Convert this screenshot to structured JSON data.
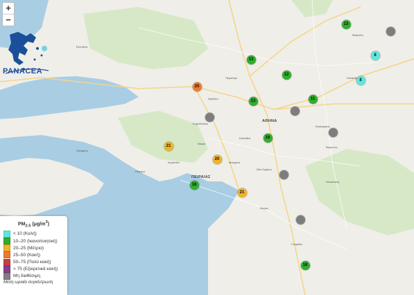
{
  "map": {
    "zoom_in": "+",
    "zoom_out": "−",
    "logo_text": "PANACEA",
    "places": [
      {
        "id": "athina",
        "label": "ΑΘΗΝΑ",
        "big": true
      },
      {
        "id": "peiraias",
        "label": "ΠΕΙΡΑΙΑΣ",
        "big": true
      },
      {
        "id": "korydallos",
        "label": "Κορυδαλλός",
        "big": false
      },
      {
        "id": "keratsini",
        "label": "Κερατσίνι",
        "big": false
      },
      {
        "id": "perama",
        "label": "Πέραμα",
        "big": false
      },
      {
        "id": "nikaia",
        "label": "Νίκαια",
        "big": false
      },
      {
        "id": "kallithea",
        "label": "Καλλιθέα",
        "big": false
      },
      {
        "id": "moschato",
        "label": "Μοσχάτο",
        "big": false
      },
      {
        "id": "neasmyrni",
        "label": "Νέα Σμύρνη",
        "big": false
      },
      {
        "id": "alimos",
        "label": "Άλιμος",
        "big": false
      },
      {
        "id": "glyfada",
        "label": "Γλυφάδα",
        "big": false
      },
      {
        "id": "marousi",
        "label": "Μαρούσι",
        "big": false
      },
      {
        "id": "chalandri",
        "label": "Χαλάνδρι",
        "big": false
      },
      {
        "id": "aigaleo",
        "label": "Αιγάλεω",
        "big": false
      },
      {
        "id": "peristeri",
        "label": "Περιστέρι",
        "big": false
      },
      {
        "id": "elefsina",
        "label": "Ελευσίνα",
        "big": false
      },
      {
        "id": "salamina",
        "label": "Σαλαμίνα",
        "big": false
      },
      {
        "id": "vyronas",
        "label": "Βύρωνας",
        "big": false
      },
      {
        "id": "kaisariani",
        "label": "Καισαριανή",
        "big": false
      },
      {
        "id": "ilioupoli",
        "label": "Ηλιούπολη",
        "big": false
      }
    ],
    "stations": [
      {
        "id": "s1",
        "value": "13",
        "category": "moderate_fair"
      },
      {
        "id": "s2",
        "value": "",
        "category": "na"
      },
      {
        "id": "s3",
        "value": "8",
        "category": "good"
      },
      {
        "id": "s4",
        "value": "8",
        "category": "good"
      },
      {
        "id": "s5",
        "value": "13",
        "category": "moderate_fair"
      },
      {
        "id": "s6",
        "value": "12",
        "category": "moderate_fair"
      },
      {
        "id": "s7",
        "value": "25",
        "category": "poor"
      },
      {
        "id": "s8",
        "value": "13",
        "category": "moderate_fair"
      },
      {
        "id": "s9",
        "value": "11",
        "category": "moderate_fair"
      },
      {
        "id": "s10",
        "value": "",
        "category": "na"
      },
      {
        "id": "s11",
        "value": "",
        "category": "na"
      },
      {
        "id": "s12",
        "value": "",
        "category": "na"
      },
      {
        "id": "s13",
        "value": "16",
        "category": "moderate_fair"
      },
      {
        "id": "s14",
        "value": "21",
        "category": "moderate"
      },
      {
        "id": "s15",
        "value": "20",
        "category": "moderate"
      },
      {
        "id": "s16",
        "value": "",
        "category": "na"
      },
      {
        "id": "s17",
        "value": "18",
        "category": "moderate_fair"
      },
      {
        "id": "s18",
        "value": "21",
        "category": "moderate"
      },
      {
        "id": "s19",
        "value": "",
        "category": "na"
      },
      {
        "id": "s20",
        "value": "18",
        "category": "moderate_fair"
      }
    ]
  },
  "legend": {
    "title": "PM2.5 (μg/m³)",
    "title_base": "PM",
    "title_sub": "2.5",
    "title_unit": "(μg/m",
    "title_sup": "3",
    "title_close": ")",
    "rows": [
      {
        "label": "< 10 (Καλή)",
        "color": "#5fe6e0"
      },
      {
        "label": "10–20 (Ικανοποιητική)",
        "color": "#2fae2b"
      },
      {
        "label": "20–25 (Μέτρια)",
        "color": "#f0b426"
      },
      {
        "label": "25–50 (Κακή)",
        "color": "#ee7a30"
      },
      {
        "label": "50–75 (Πολύ κακή)",
        "color": "#c8403f"
      },
      {
        "label": "> 75 (Εξαιρετικά κακή)",
        "color": "#8a3e8c"
      },
      {
        "label": "Μη διαθέσιμη",
        "color": "#808080"
      }
    ],
    "footer": "Μέση ωριαία συγκέντρωση"
  },
  "colors": {
    "good": "#5fe6e0",
    "moderate_fair": "#2fae2b",
    "moderate": "#f0b426",
    "poor": "#ee7a30",
    "na": "#7d7d7d",
    "sea": "#a9cde3",
    "land": "#efeee9",
    "park": "#cfe3bf"
  }
}
